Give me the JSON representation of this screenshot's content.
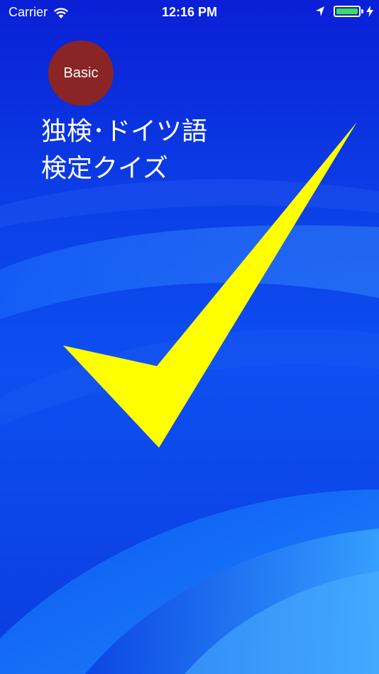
{
  "status_bar": {
    "carrier": "Carrier",
    "time": "12:16 PM",
    "wifi_icon": "wifi-icon",
    "location_icon": "location-arrow-icon",
    "battery_icon": "battery-icon",
    "charging_icon": "bolt-icon",
    "battery_color": "#3ddc5a"
  },
  "badge": {
    "label": "Basic",
    "color": "#8b2424"
  },
  "title": {
    "line1": "独検･ドイツ語",
    "line2": "検定クイズ"
  },
  "graphic": {
    "icon": "checkmark-icon",
    "color": "#ffff00"
  },
  "background": {
    "color": "#0b3fe6"
  }
}
